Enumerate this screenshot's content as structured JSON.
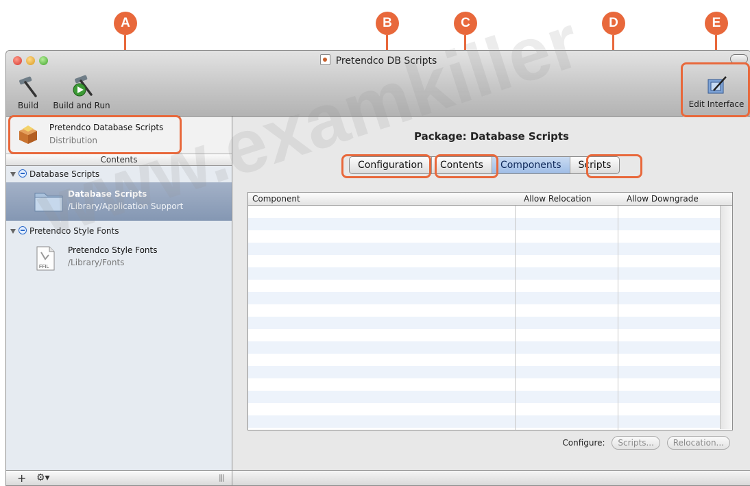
{
  "callouts": [
    "A",
    "B",
    "C",
    "D",
    "E"
  ],
  "window": {
    "title": "Pretendco DB Scripts"
  },
  "toolbar": {
    "build_label": "Build",
    "build_and_run_label": "Build and Run",
    "edit_interface_label": "Edit Interface"
  },
  "sidebar": {
    "distribution": {
      "title": "Pretendco Database Scripts",
      "subtitle": "Distribution"
    },
    "contents_header": "Contents",
    "groups": [
      {
        "label": "Database Scripts",
        "item": {
          "name": "Database Scripts",
          "path": "/Library/Application Support",
          "icon": "folder-icon"
        }
      },
      {
        "label": "Pretendco Style Fonts",
        "item": {
          "name": "Pretendco Style Fonts",
          "path": "/Library/Fonts",
          "icon": "font-file-icon",
          "icon_text": "FFIL"
        }
      }
    ]
  },
  "main": {
    "package_title": "Package: Database Scripts",
    "tabs": [
      {
        "label": "Configuration",
        "selected": false
      },
      {
        "label": "Contents",
        "selected": false
      },
      {
        "label": "Components",
        "selected": true
      },
      {
        "label": "Scripts",
        "selected": false
      }
    ],
    "table": {
      "columns": [
        "Component",
        "Allow Relocation",
        "Allow Downgrade"
      ],
      "rows": []
    },
    "configure": {
      "label": "Configure:",
      "scripts_button": "Scripts...",
      "relocation_button": "Relocation..."
    }
  },
  "watermark": "www.examkiller",
  "colors": {
    "callout": "#e8683b",
    "selection": "#8fa0bb",
    "tab_selected": "#a9c4e9"
  }
}
